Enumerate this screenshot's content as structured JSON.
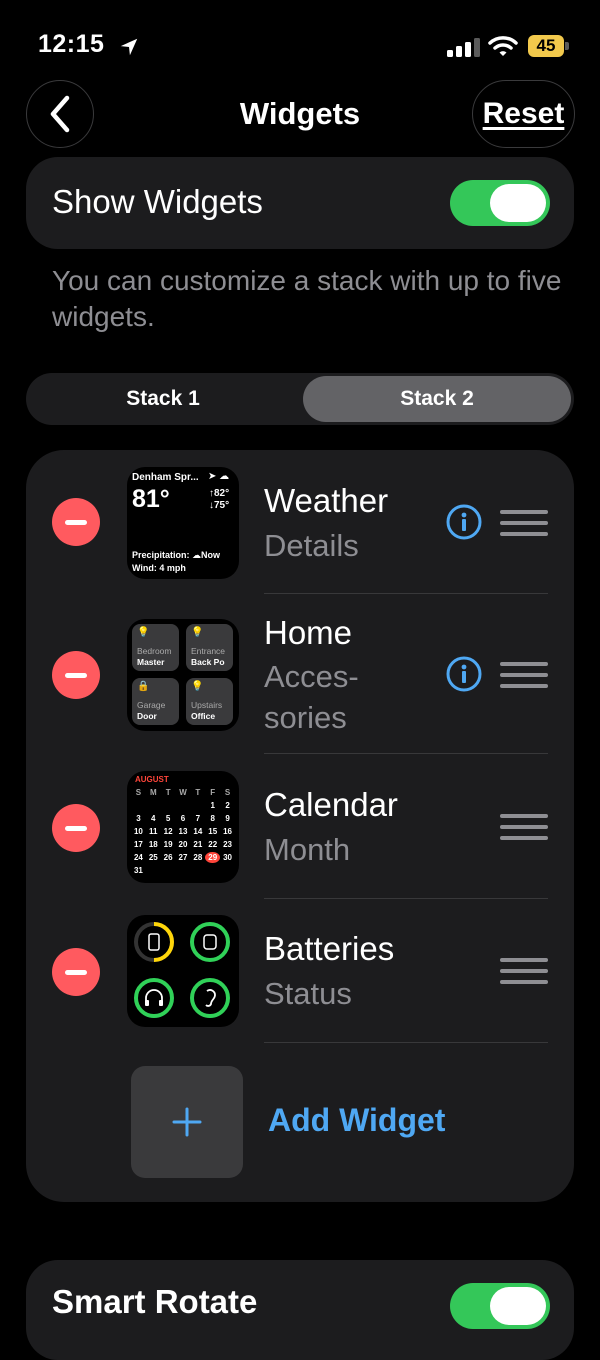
{
  "status_bar": {
    "time": "12:15",
    "battery": "45"
  },
  "nav": {
    "title": "Widgets",
    "reset": "Reset"
  },
  "show_widgets": {
    "label": "Show Widgets",
    "enabled": true
  },
  "helper_text": "You can customize a stack with up to five widgets.",
  "segments": [
    "Stack 1",
    "Stack 2"
  ],
  "selected_segment": "Stack 2",
  "widgets": [
    {
      "title": "Weather",
      "subtitle": "Details",
      "info": true
    },
    {
      "title": "Home",
      "subtitle": "Acces-\nsories",
      "info": true
    },
    {
      "title": "Calendar",
      "subtitle": "Month",
      "info": false
    },
    {
      "title": "Batteries",
      "subtitle": "Status",
      "info": false
    }
  ],
  "weather_preview": {
    "location": "Denham Spr...",
    "temp": "81°",
    "high": "↑82°",
    "low": "↓75°",
    "line1": "Precipitation: ☁Now",
    "line2": "Wind: 4 mph"
  },
  "home_preview": [
    {
      "room": "Bedroom",
      "name": "Master",
      "icon": "lightbulb-icon"
    },
    {
      "room": "Entrance",
      "name": "Back Po",
      "icon": "lightbulb-icon"
    },
    {
      "room": "Garage",
      "name": "Door",
      "icon": "lock-icon"
    },
    {
      "room": "Upstairs",
      "name": "Office",
      "icon": "lightbulb-icon"
    }
  ],
  "calendar_preview": {
    "month": "AUGUST",
    "days": [
      "S",
      "M",
      "T",
      "W",
      "T",
      "F",
      "S"
    ],
    "dates": [
      "",
      "",
      "",
      "",
      "",
      "1",
      "2",
      "3",
      "4",
      "5",
      "6",
      "7",
      "8",
      "9",
      "10",
      "11",
      "12",
      "13",
      "14",
      "15",
      "16",
      "17",
      "18",
      "19",
      "20",
      "21",
      "22",
      "23",
      "24",
      "25",
      "26",
      "27",
      "28",
      "29",
      "30",
      "31"
    ],
    "today": "29"
  },
  "add_widget": "Add Widget",
  "bottom_card": {
    "label": "Smart Rotate",
    "enabled": true
  },
  "colors": {
    "accent_blue": "#4fa8f3",
    "toggle_green": "#34c759",
    "remove_red": "#ff5a5f",
    "card": "#1c1c1e"
  }
}
